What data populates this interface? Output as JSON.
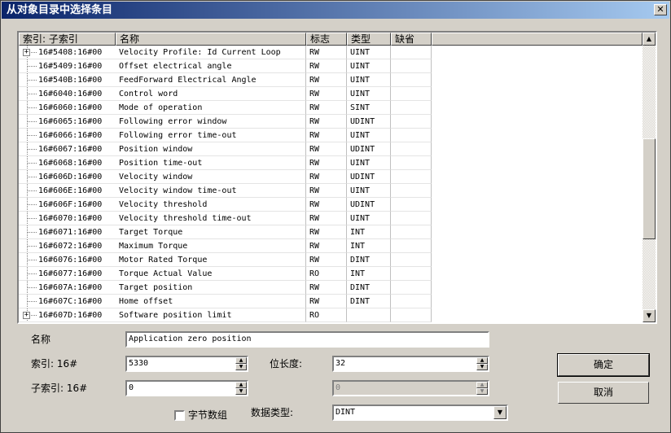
{
  "window": {
    "title": "从对象目录中选择条目",
    "close_glyph": "✕"
  },
  "list": {
    "headers": [
      "索引: 子索引",
      "名称",
      "标志",
      "类型",
      "缺省"
    ],
    "rows": [
      {
        "idx": "16#5408:16#00",
        "name": "Velocity Profile: Id Current Loop",
        "flag": "RW",
        "type": "UINT",
        "def": "",
        "expander": "+"
      },
      {
        "idx": "16#5409:16#00",
        "name": "Offset electrical angle",
        "flag": "RW",
        "type": "UINT",
        "def": ""
      },
      {
        "idx": "16#540B:16#00",
        "name": "FeedForward Electrical Angle",
        "flag": "RW",
        "type": "UINT",
        "def": ""
      },
      {
        "idx": "16#6040:16#00",
        "name": "Control word",
        "flag": "RW",
        "type": "UINT",
        "def": ""
      },
      {
        "idx": "16#6060:16#00",
        "name": "Mode of operation",
        "flag": "RW",
        "type": "SINT",
        "def": ""
      },
      {
        "idx": "16#6065:16#00",
        "name": "Following error window",
        "flag": "RW",
        "type": "UDINT",
        "def": ""
      },
      {
        "idx": "16#6066:16#00",
        "name": "Following error time-out",
        "flag": "RW",
        "type": "UINT",
        "def": ""
      },
      {
        "idx": "16#6067:16#00",
        "name": "Position window",
        "flag": "RW",
        "type": "UDINT",
        "def": ""
      },
      {
        "idx": "16#6068:16#00",
        "name": "Position time-out",
        "flag": "RW",
        "type": "UINT",
        "def": ""
      },
      {
        "idx": "16#606D:16#00",
        "name": "Velocity window",
        "flag": "RW",
        "type": "UDINT",
        "def": ""
      },
      {
        "idx": "16#606E:16#00",
        "name": "Velocity window time-out",
        "flag": "RW",
        "type": "UINT",
        "def": ""
      },
      {
        "idx": "16#606F:16#00",
        "name": "Velocity threshold",
        "flag": "RW",
        "type": "UDINT",
        "def": ""
      },
      {
        "idx": "16#6070:16#00",
        "name": "Velocity threshold time-out",
        "flag": "RW",
        "type": "UINT",
        "def": ""
      },
      {
        "idx": "16#6071:16#00",
        "name": "Target Torque",
        "flag": "RW",
        "type": "INT",
        "def": ""
      },
      {
        "idx": "16#6072:16#00",
        "name": "Maximum Torque",
        "flag": "RW",
        "type": "INT",
        "def": ""
      },
      {
        "idx": "16#6076:16#00",
        "name": "Motor Rated Torque",
        "flag": "RW",
        "type": "DINT",
        "def": ""
      },
      {
        "idx": "16#6077:16#00",
        "name": "Torque Actual Value",
        "flag": "RO",
        "type": "INT",
        "def": ""
      },
      {
        "idx": "16#607A:16#00",
        "name": "Target position",
        "flag": "RW",
        "type": "DINT",
        "def": ""
      },
      {
        "idx": "16#607C:16#00",
        "name": "Home offset",
        "flag": "RW",
        "type": "DINT",
        "def": ""
      },
      {
        "idx": "16#607D:16#00",
        "name": "Software position limit",
        "flag": "RO",
        "type": "",
        "def": "",
        "expander": "+"
      }
    ],
    "scroll_up_glyph": "▲",
    "scroll_down_glyph": "▼"
  },
  "form": {
    "name_label": "名称",
    "name_value": "Application zero position",
    "index_label": "索引: 16#",
    "index_value": "5330",
    "subindex_label": "子索引: 16#",
    "subindex_value": "0",
    "bitlen_label": "位长度:",
    "bitlen_value": "32",
    "disabled_value": "0",
    "bytearray_label": "字节数组",
    "datatype_label": "数据类型:",
    "datatype_value": "DINT",
    "spin_up": "▲",
    "spin_down": "▼",
    "combo_arrow": "▼"
  },
  "buttons": {
    "ok": "确定",
    "cancel": "取消"
  }
}
